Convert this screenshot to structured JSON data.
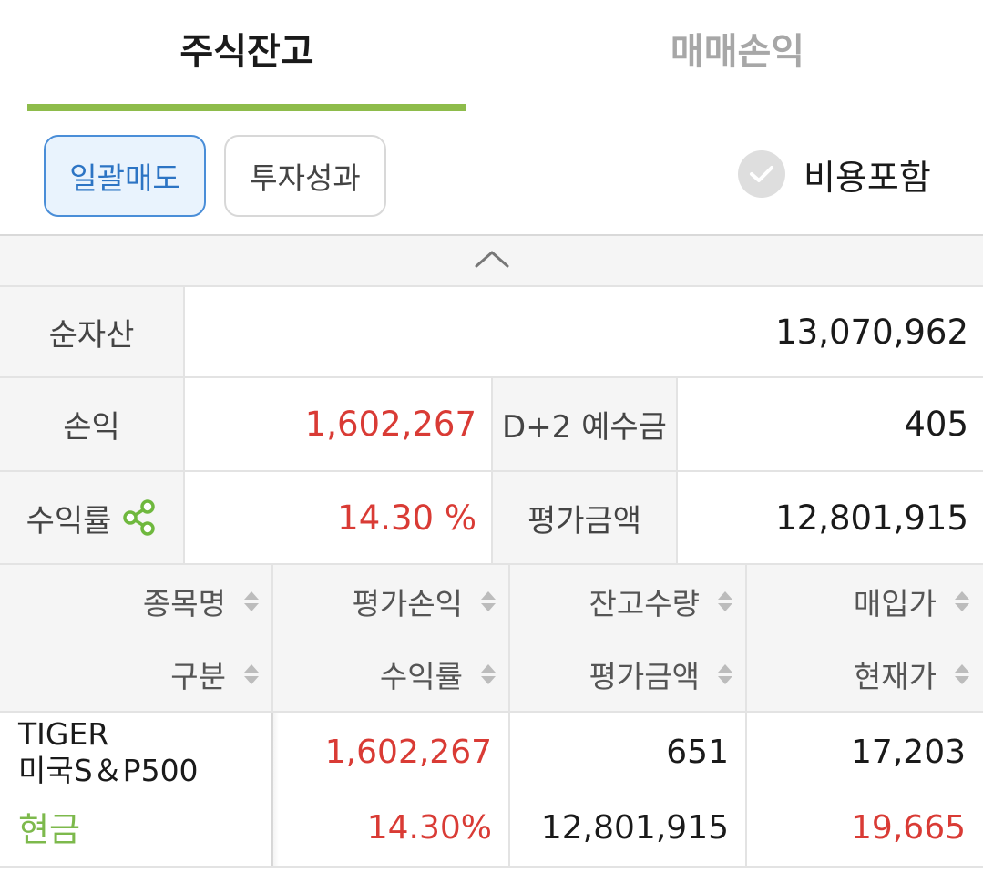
{
  "tabs": {
    "active": "주식잔고",
    "inactive": "매매손익"
  },
  "toolbar": {
    "bulk_sell": "일괄매도",
    "performance": "투자성과",
    "include_fees": "비용포함"
  },
  "summary": {
    "net_assets_label": "순자산",
    "net_assets_value": "13,070,962",
    "pnl_label": "손익",
    "pnl_value": "1,602,267",
    "deposit_label": "D+2 예수금",
    "deposit_value": "405",
    "return_label": "수익률",
    "return_value": "14.30 %",
    "eval_label": "평가금액",
    "eval_value": "12,801,915"
  },
  "table": {
    "headers_row1": [
      "종목명",
      "평가손익",
      "잔고수량",
      "매입가"
    ],
    "headers_row2": [
      "구분",
      "수익률",
      "평가금액",
      "현재가"
    ],
    "rows": [
      {
        "name_line1": "TIGER",
        "name_line2": "미국S＆P500",
        "type": "현금",
        "eval_pnl": "1,602,267",
        "return_rate": "14.30%",
        "quantity": "651",
        "eval_amount": "12,801,915",
        "buy_price": "17,203",
        "current_price": "19,665"
      }
    ]
  },
  "colors": {
    "accent_green": "#8ebc4b",
    "profit_red": "#d93b35",
    "primary_blue": "#2c74c4"
  },
  "icons": [
    "check-icon",
    "chevron-up-icon",
    "share-icon",
    "sort-icon"
  ]
}
